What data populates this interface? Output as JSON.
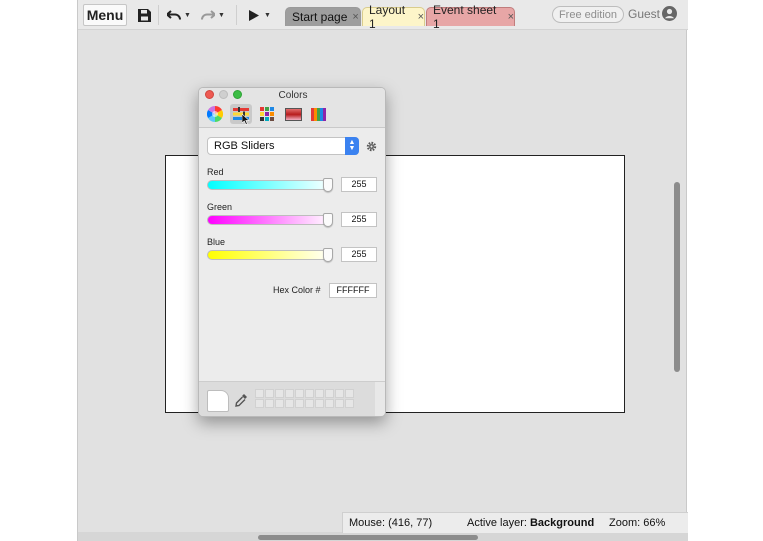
{
  "toolbar": {
    "menu_label": "Menu",
    "tabs": [
      {
        "label": "Start page",
        "close": "×"
      },
      {
        "label": "Layout 1",
        "close": "×"
      },
      {
        "label": "Event sheet 1",
        "close": "×"
      }
    ],
    "free_edition_label": "Free edition",
    "guest_label": "Guest"
  },
  "colors_panel": {
    "title": "Colors",
    "picker_mode": "RGB Sliders",
    "sliders": [
      {
        "label": "Red",
        "value": "255",
        "gradient_from": "#00ffff",
        "gradient_to": "#ffffff"
      },
      {
        "label": "Green",
        "value": "255",
        "gradient_from": "#ff00ff",
        "gradient_to": "#ffffff"
      },
      {
        "label": "Blue",
        "value": "255",
        "gradient_from": "#ffff00",
        "gradient_to": "#ffffff"
      }
    ],
    "hex_label": "Hex Color #",
    "hex_value": "FFFFFF",
    "current_color": "#ffffff"
  },
  "statusbar": {
    "mouse_label": "Mouse: (416, 77)",
    "active_layer_label": "Active layer:",
    "active_layer_value": "Background",
    "zoom_label": "Zoom: 66%"
  },
  "colors": {
    "tab_layout_bg": "#fdf5c9",
    "tab_event_bg": "#e7a6a6",
    "tab_start_bg": "#9e9e9e",
    "accent_blue": "#3b82f0"
  }
}
